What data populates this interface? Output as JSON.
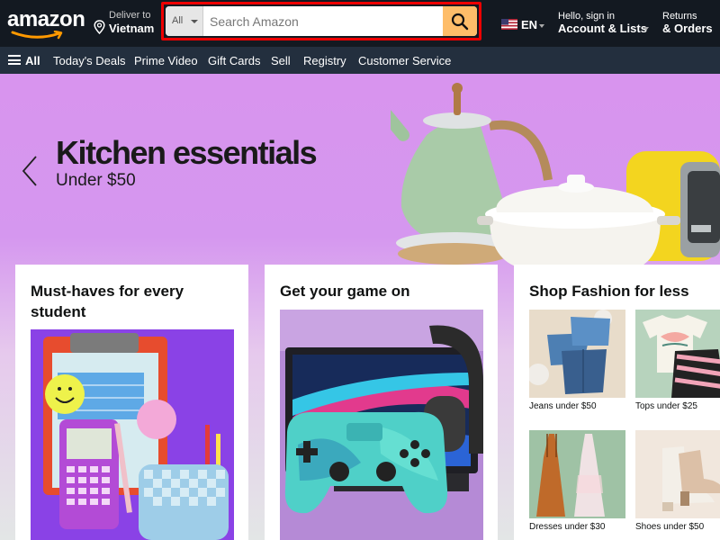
{
  "header": {
    "logo_text": "amazon",
    "deliver_label": "Deliver to",
    "deliver_location": "Vietnam",
    "search": {
      "category": "All",
      "placeholder": "Search Amazon",
      "value": ""
    },
    "language": "EN",
    "account_greeting": "Hello, sign in",
    "account_label": "Account & Lists",
    "returns_label": "Returns",
    "orders_label": "& Orders"
  },
  "subnav": {
    "all_label": "All",
    "links": [
      "Today's Deals",
      "Prime Video",
      "Gift Cards",
      "Sell",
      "Registry",
      "Customer Service"
    ]
  },
  "hero": {
    "title": "Kitchen essentials",
    "subtitle": "Under $50"
  },
  "cards": [
    {
      "title_line1": "Must-haves for every",
      "title_line2": "student"
    },
    {
      "title": "Get your game on"
    },
    {
      "title": "Shop Fashion for less",
      "tiles": [
        {
          "caption": "Jeans under $50"
        },
        {
          "caption": "Tops under $25"
        },
        {
          "caption": "Dresses under $30"
        },
        {
          "caption": "Shoes under $50"
        }
      ]
    }
  ],
  "colors": {
    "nav_bg": "#131921",
    "subnav_bg": "#232f3e",
    "search_button": "#febd69",
    "highlight_border": "#ee0000",
    "hero_bg": "#d894ee"
  }
}
